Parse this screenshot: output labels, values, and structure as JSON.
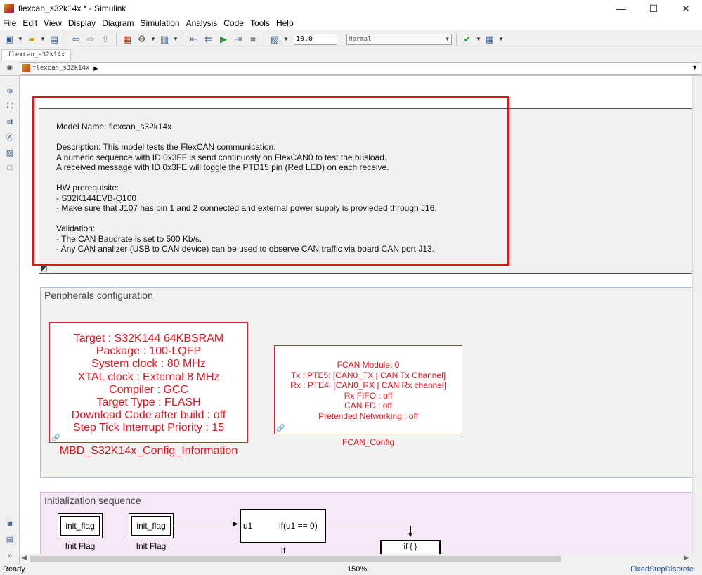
{
  "window": {
    "title": "flexcan_s32k14x * - Simulink",
    "minimize": "—",
    "maximize": "☐",
    "close": "✕"
  },
  "menu": [
    "File",
    "Edit",
    "View",
    "Display",
    "Diagram",
    "Simulation",
    "Analysis",
    "Code",
    "Tools",
    "Help"
  ],
  "toolbar": {
    "stop_time": "10.0",
    "sim_mode": "Normal"
  },
  "tab": "flexcan_s32k14x",
  "breadcrumb": "flexcan_s32k14x",
  "annotation": {
    "lines": [
      "Model Name: flexcan_s32k14x",
      "",
      "Description: This model tests the FlexCAN communication.",
      "A numeric sequence with ID 0x3FF is send continuosly on FlexCAN0 to test the busload.",
      "A received message with ID 0x3FE will toggle the PTD15 pin (Red LED) on each receive.",
      "",
      "HW prerequisite:",
      "- S32K144EVB-Q100",
      "- Make sure that J107 has pin 1 and 2 connected and external power supply is provieded through J16.",
      "",
      "Validation:",
      "- The CAN Baudrate is set to 500 Kb/s.",
      "- Any CAN analizer (USB to CAN device) can be used to observe CAN traffic via board CAN port J13."
    ]
  },
  "peripherals": {
    "title": "Peripherals configuration",
    "config_info": {
      "lines": [
        "Target : S32K144 64KBSRAM",
        "Package : 100-LQFP",
        "System clock : 80 MHz",
        "XTAL clock : External 8 MHz",
        "Compiler : GCC",
        "Target Type : FLASH",
        "Download Code after build : off",
        "Step Tick Interrupt Priority : 15"
      ],
      "label": "MBD_S32K14x_Config_Information"
    },
    "fcan_config": {
      "lines": [
        "FCAN Module: 0",
        "Tx : PTE5: [CAN0_TX | CAN Tx Channel]",
        "Rx : PTE4: [CAN0_RX | CAN Rx channel]",
        "Rx FIFO : off",
        "CAN FD : off",
        "Pretended Networking : off"
      ],
      "label": "FCAN_Config"
    }
  },
  "init_seq": {
    "title": "Initialization sequence",
    "block1": {
      "text": "init_flag",
      "label": "Init Flag"
    },
    "block2": {
      "text": "init_flag",
      "label": "Init Flag"
    },
    "if_block": {
      "port": "u1",
      "cond": "if(u1 == 0)",
      "label": "If"
    },
    "action": {
      "text": "if { }"
    }
  },
  "status": {
    "left": "Ready",
    "zoom": "150%",
    "solver": "FixedStepDiscrete"
  }
}
